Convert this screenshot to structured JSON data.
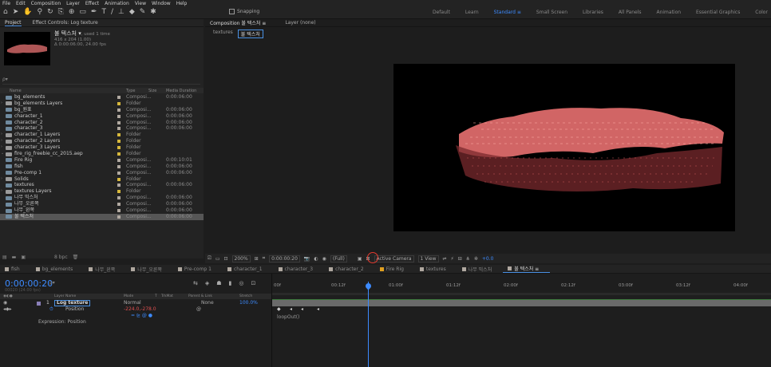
{
  "menu": [
    "File",
    "Edit",
    "Composition",
    "Layer",
    "Effect",
    "Animation",
    "View",
    "Window",
    "Help"
  ],
  "toolbar": {
    "snapping": "Snapping"
  },
  "workspaces": [
    "Default",
    "Learn",
    "Standard",
    "Small Screen",
    "Libraries",
    "All Panels",
    "Animation",
    "Essential Graphics",
    "Color"
  ],
  "active_workspace": "Standard",
  "project": {
    "tab_project": "Project",
    "tab_effect": "Effect Controls: Log texture",
    "comp_name": "불 텍스처 ▾",
    "used": ", used 1 time",
    "dims": "416 x 204 (1.00)",
    "duration": "Δ 0:00:06:00, 24.00 fps",
    "search_placeholder": "ρ▾",
    "headers": {
      "name": "Name",
      "type": "Type",
      "size": "Size",
      "duration": "Media Duration"
    },
    "bpc": "8 bpc"
  },
  "project_items": [
    {
      "name": "bg_elements",
      "type": "Composi...",
      "dur": "0:00:06:00",
      "color": "#b0a8a0",
      "icon": "comp"
    },
    {
      "name": "bg_elements Layers",
      "type": "Folder",
      "dur": "",
      "color": "#d6b73c",
      "icon": "folder",
      "arrow": "›"
    },
    {
      "name": "bg_원표",
      "type": "Composi...",
      "dur": "0:00:06:00",
      "color": "#b0a8a0",
      "icon": "comp"
    },
    {
      "name": "character_1",
      "type": "Composi...",
      "dur": "0:00:06:00",
      "color": "#b0a8a0",
      "icon": "comp"
    },
    {
      "name": "character_2",
      "type": "Composi...",
      "dur": "0:00:06:00",
      "color": "#b0a8a0",
      "icon": "comp"
    },
    {
      "name": "character_3",
      "type": "Composi...",
      "dur": "0:00:06:00",
      "color": "#b0a8a0",
      "icon": "comp"
    },
    {
      "name": "character_1 Layers",
      "type": "Folder",
      "dur": "",
      "color": "#d6b73c",
      "icon": "folder",
      "arrow": "›"
    },
    {
      "name": "character_2 Layers",
      "type": "Folder",
      "dur": "",
      "color": "#d6b73c",
      "icon": "folder",
      "arrow": "›"
    },
    {
      "name": "character_3 Layers",
      "type": "Folder",
      "dur": "",
      "color": "#d6b73c",
      "icon": "folder",
      "arrow": "›"
    },
    {
      "name": "fire_rig_freebie_cc_2015.aep",
      "type": "Folder",
      "dur": "",
      "color": "#d6b73c",
      "icon": "folder",
      "arrow": "⌄"
    },
    {
      "name": "  Fire Rig",
      "type": "Composi...",
      "dur": "0:00:10:01",
      "color": "#b0a8a0",
      "icon": "comp"
    },
    {
      "name": "fish",
      "type": "Composi...",
      "dur": "0:00:06:00",
      "color": "#b0a8a0",
      "icon": "comp"
    },
    {
      "name": "Pre-comp 1",
      "type": "Composi...",
      "dur": "0:00:06:00",
      "color": "#b0a8a0",
      "icon": "comp"
    },
    {
      "name": "Solids",
      "type": "Folder",
      "dur": "",
      "color": "#d6b73c",
      "icon": "folder",
      "arrow": "›"
    },
    {
      "name": "textures",
      "type": "Composi...",
      "dur": "0:00:06:00",
      "color": "#b0a8a0",
      "icon": "comp"
    },
    {
      "name": "textures Layers",
      "type": "Folder",
      "dur": "",
      "color": "#d6b73c",
      "icon": "folder",
      "arrow": "›"
    },
    {
      "name": "나무 믹스처",
      "type": "Composi...",
      "dur": "0:00:06:00",
      "color": "#b0a8a0",
      "icon": "comp"
    },
    {
      "name": "나무_오른쪽",
      "type": "Composi...",
      "dur": "0:00:06:00",
      "color": "#b0a8a0",
      "icon": "comp"
    },
    {
      "name": "나무_왼쪽",
      "type": "Composi...",
      "dur": "0:00:06:00",
      "color": "#b0a8a0",
      "icon": "comp"
    },
    {
      "name": "불 텍스처",
      "type": "Composi...",
      "dur": "0:00:06:00",
      "color": "#b0a8a0",
      "icon": "comp",
      "selected": true
    }
  ],
  "composition": {
    "tab": "Composition 불 텍스처 ≡",
    "layer_tab": "Layer (none)",
    "breadcrumbs": [
      "textures",
      "불 텍스처"
    ],
    "footer": {
      "zoom": "200%",
      "timecode": "0:00:00:20",
      "res": "(Full)",
      "camera": "Active Camera",
      "views": "1 View",
      "offset": "+0.0"
    }
  },
  "timeline": {
    "tabs": [
      {
        "label": "fish",
        "color": "#b0a8a0"
      },
      {
        "label": "bg_elements",
        "color": "#b0a8a0"
      },
      {
        "label": "나무_왼쪽",
        "color": "#b0a8a0"
      },
      {
        "label": "나무_오른쪽",
        "color": "#b0a8a0"
      },
      {
        "label": "Pre-comp 1",
        "color": "#b0a8a0"
      },
      {
        "label": "character_1",
        "color": "#b0a8a0"
      },
      {
        "label": "character_3",
        "color": "#b0a8a0"
      },
      {
        "label": "character_2",
        "color": "#b0a8a0"
      },
      {
        "label": "Fire Rig",
        "color": "#e0a020"
      },
      {
        "label": "textures",
        "color": "#b0a8a0"
      },
      {
        "label": "나무 믹스처",
        "color": "#b0a8a0"
      },
      {
        "label": "불 텍스처 ≡",
        "color": "#b0a8a0",
        "active": true
      }
    ],
    "timecode": "0:00:00:20",
    "fps": "00020 (24.00 fps)",
    "search": "ρ▾",
    "headers": {
      "layer": "Layer Name",
      "mode": "Mode",
      "t": "T",
      "trkmat": "TrkMat",
      "parent": "Parent & Link",
      "stretch": "Stretch"
    },
    "layer": {
      "num": "1",
      "name": "Log texture",
      "mode": "Normal",
      "parent": "None",
      "stretch": "100.0%"
    },
    "prop": {
      "name": "Position",
      "value": "-224.0,-278.0"
    },
    "expression": "Expression: Position",
    "expr_code": "loopOut()",
    "ruler": [
      "00f",
      "00:12f",
      "01:00f",
      "01:12f",
      "02:00f",
      "02:12f",
      "03:00f",
      "03:12f",
      "04:00f"
    ]
  },
  "colors": {
    "accent": "#3d8bff",
    "highlight": "#e23a2f",
    "fire": "#e87070"
  }
}
